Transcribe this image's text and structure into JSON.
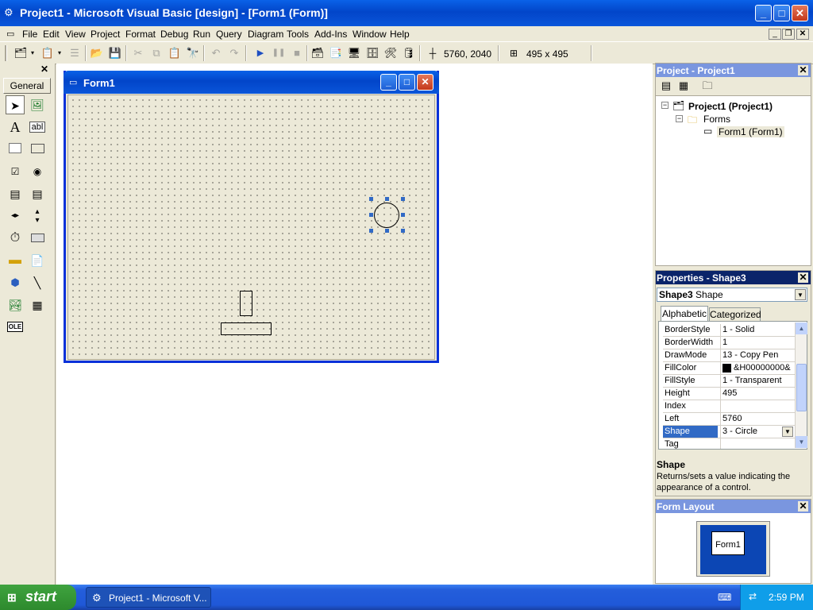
{
  "window": {
    "title": "Project1 - Microsoft Visual Basic [design] - [Form1 (Form)]",
    "minimize_glyph": "_",
    "maximize_glyph": "□",
    "close_glyph": "✕"
  },
  "menu": [
    "File",
    "Edit",
    "View",
    "Project",
    "Format",
    "Debug",
    "Run",
    "Query",
    "Diagram",
    "Tools",
    "Add-Ins",
    "Window",
    "Help"
  ],
  "toolbar": {
    "position_readout": "5760, 2040",
    "size_readout": "495 x 495"
  },
  "toolbox": {
    "tab_label": "General",
    "close_glyph": "✕",
    "tools": [
      "pointer",
      "picturebox",
      "label",
      "textbox",
      "frame",
      "commandbutton",
      "checkbox",
      "optionbutton",
      "combobox",
      "listbox",
      "hscrollbar",
      "vscrollbar",
      "timer",
      "drivelist",
      "dirlist",
      "filelist",
      "shape",
      "line",
      "image",
      "data",
      "ole"
    ]
  },
  "form": {
    "title": "Form1"
  },
  "project_panel": {
    "title": "Project - Project1",
    "root": "Project1 (Project1)",
    "folder": "Forms",
    "item": "Form1 (Form1)"
  },
  "properties_panel": {
    "title": "Properties - Shape3",
    "object_name": "Shape3",
    "object_type": "Shape",
    "tabs": [
      "Alphabetic",
      "Categorized"
    ],
    "rows": [
      {
        "name": "BorderStyle",
        "value": "1 - Solid"
      },
      {
        "name": "BorderWidth",
        "value": "1"
      },
      {
        "name": "DrawMode",
        "value": "13 - Copy Pen"
      },
      {
        "name": "FillColor",
        "value": "&H00000000&"
      },
      {
        "name": "FillStyle",
        "value": "1 - Transparent"
      },
      {
        "name": "Height",
        "value": "495"
      },
      {
        "name": "Index",
        "value": ""
      },
      {
        "name": "Left",
        "value": "5760"
      },
      {
        "name": "Shape",
        "value": "3 - Circle"
      },
      {
        "name": "Tag",
        "value": ""
      }
    ],
    "selected_row": "Shape",
    "description_title": "Shape",
    "description_text": "Returns/sets a value indicating the appearance of a control."
  },
  "form_layout_panel": {
    "title": "Form Layout",
    "preview_label": "Form1"
  },
  "taskbar": {
    "start_label": "start",
    "task_label": "Project1 - Microsoft V...",
    "clock": "2:59 PM"
  },
  "colors": {
    "title_blue": "#0245c9",
    "selection_blue": "#316ac5",
    "panel_active": "#0a246a",
    "panel_inactive": "#7a96df",
    "monitor_blue": "#0c46b4"
  }
}
